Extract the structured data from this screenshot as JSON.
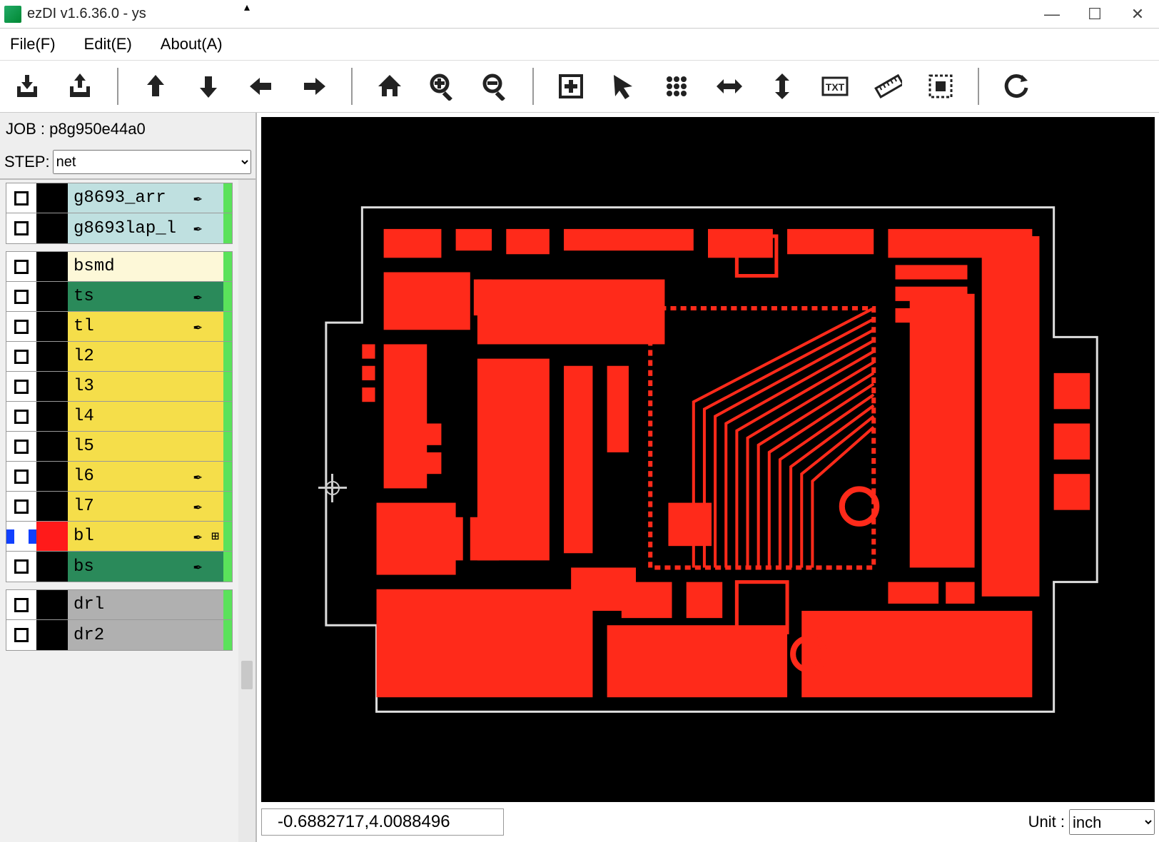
{
  "window": {
    "title": "ezDI v1.6.36.0 - ys"
  },
  "menu": {
    "file": "File(F)",
    "edit": "Edit(E)",
    "about": "About(A)"
  },
  "toolbar_names": [
    "import",
    "export",
    "up",
    "down",
    "left",
    "right",
    "home",
    "zoom-in",
    "zoom-out",
    "add-box",
    "pointer",
    "grid",
    "h-arrows",
    "v-arrows",
    "txt",
    "ruler",
    "select-area",
    "refresh"
  ],
  "sidebar": {
    "job_label": "JOB :",
    "job_value": "p8g950e44a0",
    "step_label": "STEP:",
    "step_value": "net",
    "groups": [
      {
        "items": [
          {
            "name": "g8693_arr",
            "swatch": "#000",
            "bg": "#bfe0e0",
            "indic": "#5be25b",
            "flag": "✒"
          },
          {
            "name": "g8693lap_l",
            "swatch": "#000",
            "bg": "#bfe0e0",
            "indic": "#5be25b",
            "flag": "✒"
          }
        ]
      },
      {
        "items": [
          {
            "name": "bsmd",
            "swatch": "#000",
            "bg": "#fdf8d8",
            "indic": "#5be25b"
          },
          {
            "name": "ts",
            "swatch": "#000",
            "bg": "#2a8a5a",
            "indic": "#5be25b",
            "flag": "✒"
          },
          {
            "name": "tl",
            "swatch": "#000",
            "bg": "#f5de4a",
            "indic": "#5be25b",
            "flag": "✒"
          },
          {
            "name": "l2",
            "swatch": "#000",
            "bg": "#f5de4a",
            "indic": "#5be25b"
          },
          {
            "name": "l3",
            "swatch": "#000",
            "bg": "#f5de4a",
            "indic": "#5be25b"
          },
          {
            "name": "l4",
            "swatch": "#000",
            "bg": "#f5de4a",
            "indic": "#5be25b"
          },
          {
            "name": "l5",
            "swatch": "#000",
            "bg": "#f5de4a",
            "indic": "#5be25b"
          },
          {
            "name": "l6",
            "swatch": "#000",
            "bg": "#f5de4a",
            "indic": "#5be25b",
            "flag": "✒"
          },
          {
            "name": "l7",
            "swatch": "#000",
            "bg": "#f5de4a",
            "indic": "#5be25b",
            "flag": "✒"
          },
          {
            "name": "bl",
            "swatch": "#ff1a1a",
            "bg": "#f5de4a",
            "indic": "#5be25b",
            "flag": "✒",
            "flag2": "⊞",
            "selected": true
          },
          {
            "name": "bs",
            "swatch": "#000",
            "bg": "#2a8a5a",
            "indic": "#5be25b",
            "flag": "✒"
          }
        ]
      },
      {
        "items": [
          {
            "name": "drl",
            "swatch": "#000",
            "bg": "#b0b0b0",
            "indic": "#5be25b"
          },
          {
            "name": "dr2",
            "swatch": "#000",
            "bg": "#b0b0b0",
            "indic": "#5be25b"
          }
        ]
      }
    ]
  },
  "status": {
    "coords": "-0.6882717,4.0088496",
    "unit_label": "Unit :",
    "unit": "inch"
  }
}
